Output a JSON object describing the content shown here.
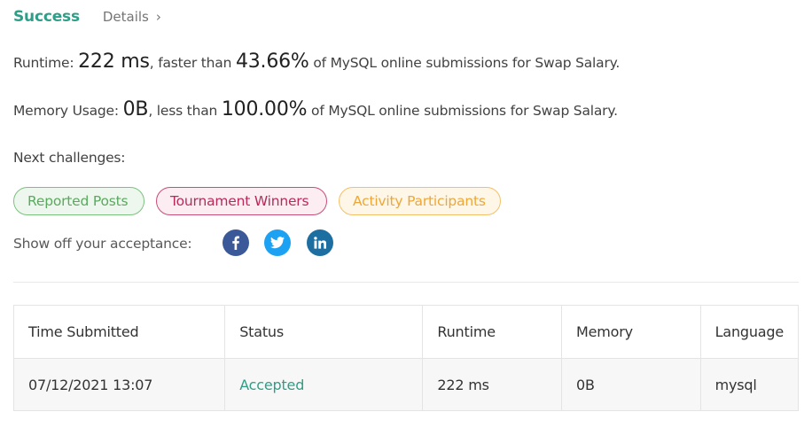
{
  "header": {
    "status": "Success",
    "details_label": "Details",
    "details_chevron": "›"
  },
  "runtime": {
    "prefix": "Runtime: ",
    "value": "222 ms",
    "middle": ", faster than ",
    "percent": "43.66%",
    "suffix": " of MySQL online submissions for Swap Salary."
  },
  "memory": {
    "prefix": "Memory Usage: ",
    "value": "0B",
    "middle": ", less than ",
    "percent": "100.00%",
    "suffix": " of MySQL online submissions for Swap Salary."
  },
  "next_challenges": {
    "label": "Next challenges:",
    "items": [
      "Reported Posts",
      "Tournament Winners",
      "Activity Participants"
    ]
  },
  "share": {
    "label": "Show off your acceptance:",
    "icons": [
      "facebook-icon",
      "twitter-icon",
      "linkedin-icon"
    ],
    "colors": {
      "facebook": "#3b5998",
      "twitter": "#1da1f2",
      "linkedin": "#1c6fa0"
    }
  },
  "table": {
    "headers": [
      "Time Submitted",
      "Status",
      "Runtime",
      "Memory",
      "Language"
    ],
    "rows": [
      [
        "07/12/2021 13:07",
        "Accepted",
        "222 ms",
        "0B",
        "mysql"
      ]
    ]
  },
  "colors": {
    "accent": "#2e9e88",
    "chip_green": "#5aa95e",
    "chip_red": "#b82a5a",
    "chip_orange": "#eea737"
  }
}
